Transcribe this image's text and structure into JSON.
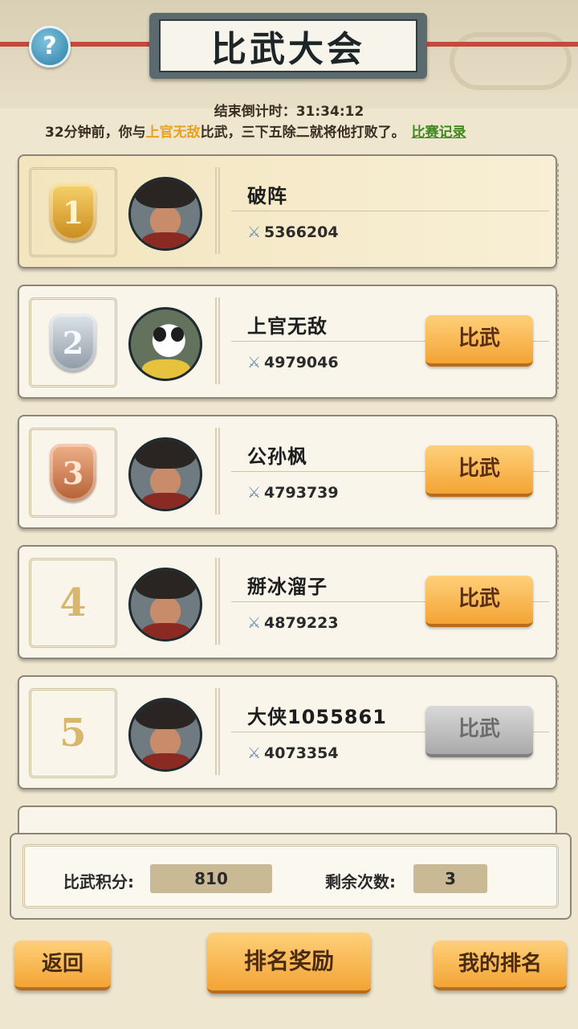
{
  "header": {
    "title": "比武大会",
    "help_label": "?"
  },
  "countdown": {
    "label": "结束倒计时：",
    "value": "31:34:12"
  },
  "notice": {
    "prefix": "32分钟前，你与",
    "opponent": "上官无敌",
    "suffix": "比武，三下五除二就将他打败了。",
    "record_link": "比赛记录"
  },
  "players": [
    {
      "rank": "1",
      "name": "破阵",
      "power": "5366204",
      "action": "",
      "action_enabled": false
    },
    {
      "rank": "2",
      "name": "上官无敌",
      "power": "4979046",
      "action": "比武",
      "action_enabled": true
    },
    {
      "rank": "3",
      "name": "公孙枫",
      "power": "4793739",
      "action": "比武",
      "action_enabled": true
    },
    {
      "rank": "4",
      "name": "掰冰溜子",
      "power": "4879223",
      "action": "比武",
      "action_enabled": true
    },
    {
      "rank": "5",
      "name": "大侠1055861",
      "power": "4073354",
      "action": "比武",
      "action_enabled": false
    }
  ],
  "stats": {
    "score_label": "比武积分:",
    "score_value": "810",
    "remaining_label": "剩余次数:",
    "remaining_value": "3"
  },
  "footer": {
    "back": "返回",
    "rewards": "排名奖励",
    "my_rank": "我的排名"
  },
  "colors": {
    "accent_button": "#f3a434",
    "disabled_button": "#a9a9a9",
    "highlight_name": "#e7a21f",
    "link": "#3d8a1d"
  },
  "icons": {
    "power": "crossed-swords-icon",
    "help": "question-mark-icon"
  }
}
